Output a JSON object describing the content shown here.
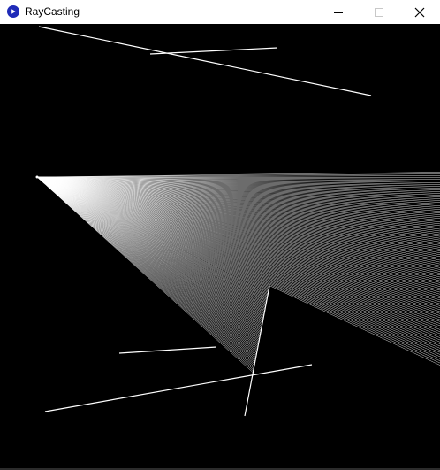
{
  "window": {
    "title": "RayCasting",
    "icon": "processing-app-icon",
    "controls": [
      "minimize-icon",
      "maximize-icon",
      "close-icon"
    ]
  },
  "colors": {
    "titlebar_bg": "#ffffff",
    "canvas_bg": "#000000",
    "wall": "#ffffff",
    "ray": "#ffffff",
    "app_icon": "#1f2bb8",
    "disabled_control": "#c8c8c8"
  }
}
